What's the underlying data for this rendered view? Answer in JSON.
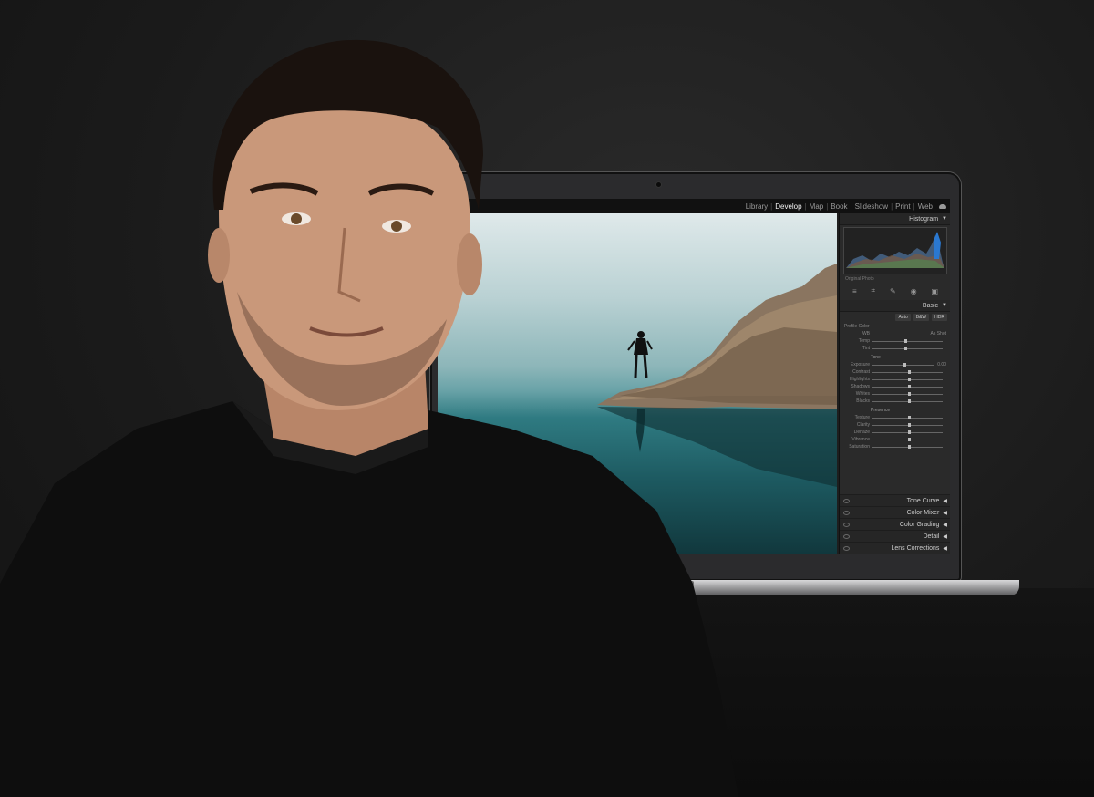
{
  "lightroom": {
    "modules": [
      "Library",
      "Develop",
      "Map",
      "Book",
      "Slideshow",
      "Print",
      "Web"
    ],
    "active_module": "Develop",
    "histogram_label": "Histogram",
    "original_photo": "Original Photo",
    "basic_label": "Basic",
    "buttons": [
      "Auto",
      "B&W",
      "HDR"
    ],
    "profile_label": "Profile",
    "profile_value": "Color",
    "wb_label": "WB",
    "wb_value": "As Shot",
    "temp_label": "Temp",
    "tint_label": "Tint",
    "tone_label": "Tone",
    "tone_rows": [
      "Exposure",
      "Contrast",
      "Highlights",
      "Shadows",
      "Whites",
      "Blacks"
    ],
    "exposure_value": "0.00",
    "presence_label": "Presence",
    "presence_rows": [
      "Texture",
      "Clarity",
      "Dehaze",
      "Vibrance",
      "Saturation"
    ],
    "collapsed_panels": [
      "Tone Curve",
      "Color Mixer",
      "Color Grading",
      "Detail",
      "Lens Corrections"
    ]
  }
}
